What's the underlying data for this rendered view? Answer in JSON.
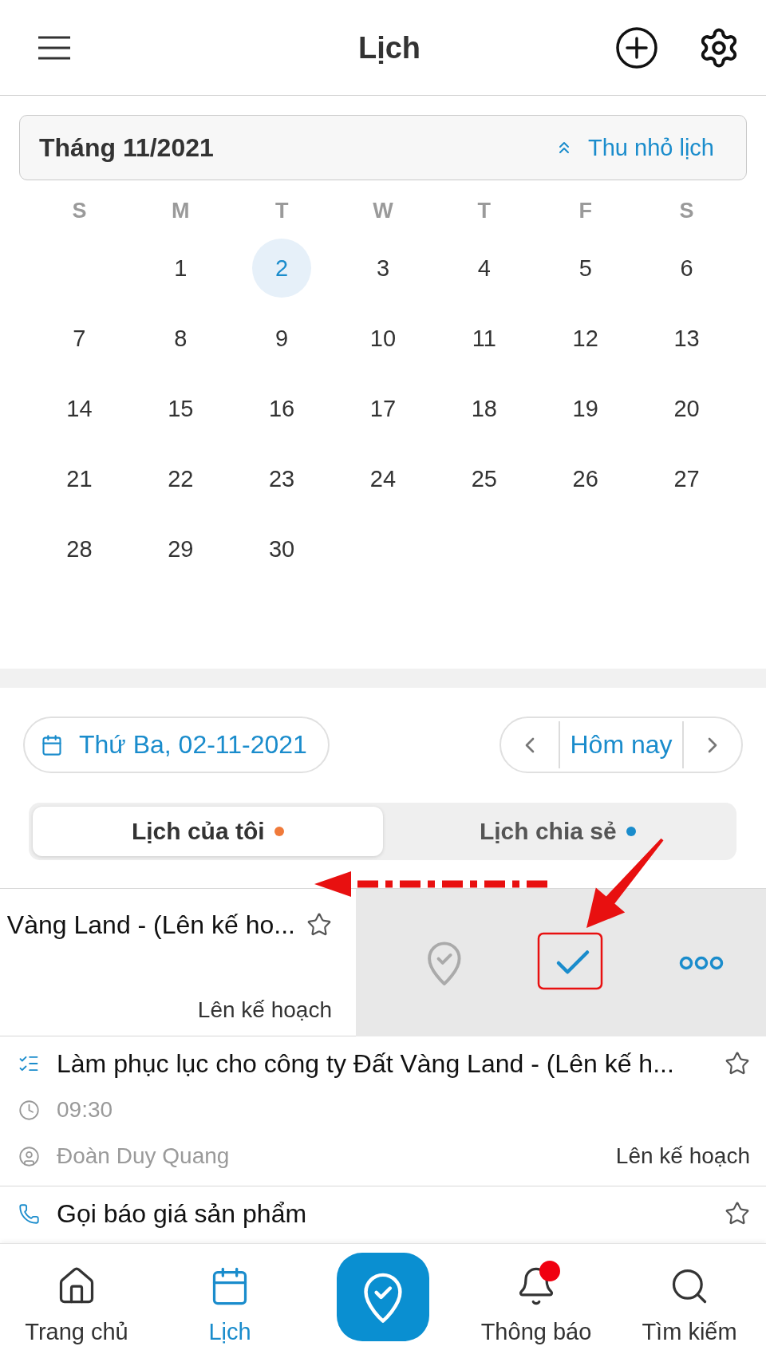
{
  "header": {
    "title": "Lịch"
  },
  "month_bar": {
    "title": "Tháng 11/2021",
    "collapse_label": "Thu nhỏ lịch"
  },
  "calendar": {
    "weekdays": [
      "S",
      "M",
      "T",
      "W",
      "T",
      "F",
      "S"
    ],
    "weeks": [
      [
        {
          "label": "1",
          "selected": false
        },
        {
          "label": "2",
          "selected": true
        },
        {
          "label": "3",
          "selected": false
        },
        {
          "label": "4",
          "selected": false
        },
        {
          "label": "5",
          "selected": false
        },
        {
          "label": "6",
          "selected": false
        }
      ],
      [
        {
          "label": "7",
          "selected": false
        },
        {
          "label": "8",
          "selected": false
        },
        {
          "label": "9",
          "selected": false
        },
        {
          "label": "10",
          "selected": false
        },
        {
          "label": "11",
          "selected": false
        },
        {
          "label": "12",
          "selected": false
        },
        {
          "label": "13",
          "selected": false
        }
      ],
      [
        {
          "label": "14",
          "selected": false
        },
        {
          "label": "15",
          "selected": false
        },
        {
          "label": "16",
          "selected": false
        },
        {
          "label": "17",
          "selected": false
        },
        {
          "label": "18",
          "selected": false
        },
        {
          "label": "19",
          "selected": false
        },
        {
          "label": "20",
          "selected": false
        }
      ],
      [
        {
          "label": "21",
          "selected": false
        },
        {
          "label": "22",
          "selected": false
        },
        {
          "label": "23",
          "selected": false
        },
        {
          "label": "24",
          "selected": false
        },
        {
          "label": "25",
          "selected": false
        },
        {
          "label": "26",
          "selected": false
        },
        {
          "label": "27",
          "selected": false
        }
      ],
      [
        {
          "label": "28",
          "selected": false
        },
        {
          "label": "29",
          "selected": false
        },
        {
          "label": "30",
          "selected": false
        }
      ]
    ]
  },
  "date_nav": {
    "date_label": "Thứ Ba, 02-11-2021",
    "today_label": "Hôm nay"
  },
  "tabs": [
    {
      "label": "Lịch của tôi",
      "selected": true,
      "color": "#f07a3a"
    },
    {
      "label": "Lịch chia sẻ",
      "selected": false,
      "color": "#1a8ccc"
    }
  ],
  "events": [
    {
      "swiped": true,
      "title": "Vàng Land - (Lên kế ho...",
      "status": "Lên kế hoạch"
    },
    {
      "swiped": false,
      "kind": "task",
      "title": "Làm phục lục cho công ty Đất Vàng Land - (Lên kế h...",
      "time": "09:30",
      "owner": "Đoàn Duy Quang",
      "status": "Lên kế hoạch"
    },
    {
      "swiped": false,
      "kind": "call",
      "title": "Gọi báo giá sản phẩm"
    }
  ],
  "bottom_nav": {
    "items": [
      {
        "kind": "tab",
        "label": "Trang chủ",
        "selected": false,
        "alert": false
      },
      {
        "kind": "tab",
        "label": "Lịch",
        "selected": true,
        "alert": false
      },
      {
        "kind": "action"
      },
      {
        "kind": "tab",
        "label": "Thông báo",
        "selected": false,
        "alert": true
      },
      {
        "kind": "tab",
        "label": "Tìm kiếm",
        "selected": false,
        "alert": false
      }
    ]
  }
}
